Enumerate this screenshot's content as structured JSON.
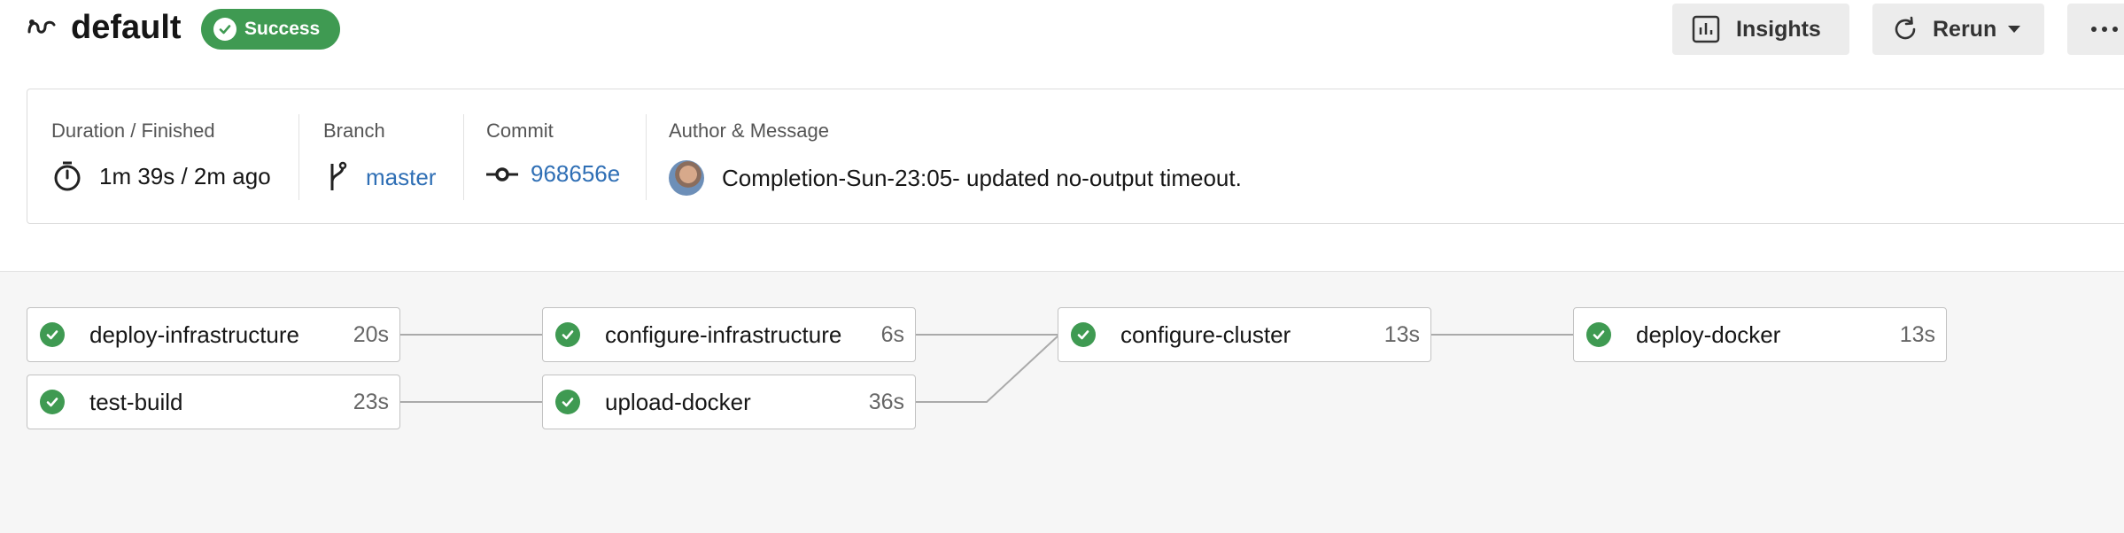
{
  "header": {
    "workflow_icon": "workflow-icon",
    "title": "default",
    "status": {
      "label": "Success",
      "color": "#3f9a52",
      "icon": "check-circle-icon"
    }
  },
  "actions": {
    "insights": {
      "label": "Insights",
      "icon": "bar-chart-icon"
    },
    "rerun": {
      "label": "Rerun",
      "icon": "refresh-icon",
      "dropdown_icon": "caret-down-icon"
    },
    "more": {
      "label": "···",
      "icon": "more-icon"
    }
  },
  "summary": {
    "duration": {
      "label": "Duration / Finished",
      "value": "1m 39s / 2m ago",
      "icon": "stopwatch-icon"
    },
    "branch": {
      "label": "Branch",
      "value": "master",
      "icon": "git-branch-icon"
    },
    "commit": {
      "label": "Commit",
      "value": "968656e",
      "icon": "git-commit-icon"
    },
    "author": {
      "label": "Author & Message",
      "message": "Completion-Sun-23:05- updated no-output timeout.",
      "icon": "avatar"
    }
  },
  "jobs": [
    {
      "name": "deploy-infrastructure",
      "duration": "20s",
      "status": "success"
    },
    {
      "name": "test-build",
      "duration": "23s",
      "status": "success"
    },
    {
      "name": "configure-infrastructure",
      "duration": "6s",
      "status": "success"
    },
    {
      "name": "upload-docker",
      "duration": "36s",
      "status": "success"
    },
    {
      "name": "configure-cluster",
      "duration": "13s",
      "status": "success"
    },
    {
      "name": "deploy-docker",
      "duration": "13s",
      "status": "success"
    }
  ],
  "colors": {
    "success": "#3f9a52",
    "link": "#2f6fb5",
    "graph_bg": "#f6f6f6"
  }
}
